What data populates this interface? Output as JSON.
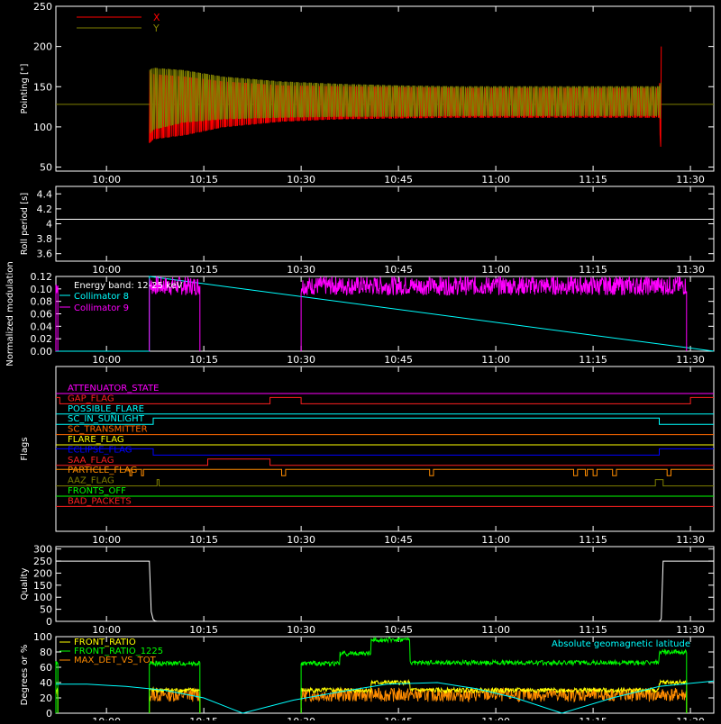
{
  "x_ticks": [
    "10:00",
    "10:15",
    "10:30",
    "10:45",
    "11:00",
    "11:15",
    "11:30"
  ],
  "x_tick_hours": [
    10.0,
    10.25,
    10.5,
    10.75,
    11.0,
    11.25,
    11.5
  ],
  "chart_data": [
    {
      "type": "line",
      "ylabel": "Pointing [\"]",
      "ylim": [
        45,
        250
      ],
      "yticks": [
        50,
        100,
        150,
        200,
        250
      ],
      "xlim": [
        9.87,
        11.56
      ],
      "legend_placement": "top-left",
      "series": [
        {
          "name": "X",
          "color": "#ff0000",
          "x": [
            10.11,
            10.12,
            10.2,
            10.3,
            10.45,
            10.6,
            10.75,
            10.9,
            11.05,
            11.2,
            11.3,
            11.42,
            11.425
          ],
          "center": [
            125,
            125,
            126,
            128,
            129,
            130,
            130,
            130,
            130,
            130,
            130,
            130,
            130
          ],
          "half_amp": [
            45,
            40,
            36,
            28,
            22,
            20,
            19,
            18,
            18,
            18,
            18,
            18,
            70
          ]
        },
        {
          "name": "Y",
          "color": "#808000",
          "x": [
            10.11,
            10.12,
            10.2,
            10.3,
            10.45,
            10.6,
            10.75,
            10.9,
            11.05,
            11.2,
            11.3,
            11.42,
            11.425
          ],
          "center": [
            130,
            135,
            138,
            136,
            134,
            133,
            132,
            132,
            132,
            132,
            132,
            132,
            130
          ],
          "half_amp": [
            40,
            38,
            32,
            26,
            22,
            20,
            19,
            18,
            18,
            18,
            18,
            18,
            25
          ]
        }
      ],
      "baseline": 128
    },
    {
      "type": "line",
      "ylabel": "Roll period [s]",
      "ylim": [
        3.5,
        4.5
      ],
      "yticks": [
        3.6,
        3.8,
        4.0,
        4.2,
        4.4
      ],
      "xlim": [
        9.87,
        11.56
      ],
      "series": [
        {
          "x": [
            9.87,
            11.56
          ],
          "y": [
            4.06,
            4.06
          ],
          "color": "#ffffff"
        }
      ]
    },
    {
      "type": "line",
      "ylabel": "Normalized modulation",
      "ylim": [
        0,
        0.12
      ],
      "yticks": [
        0.0,
        0.02,
        0.04,
        0.06,
        0.08,
        0.1,
        0.12
      ],
      "ytick_labels": [
        "0.00",
        "0.02",
        "0.04",
        "0.06",
        "0.08",
        "0.10",
        "0.12"
      ],
      "xlim": [
        9.87,
        11.56
      ],
      "legend": {
        "title": "Energy band: 12-25 keV",
        "entries": [
          "Collimator 8",
          "Collimator 9"
        ]
      },
      "series": [
        {
          "name": "Collimator 8",
          "color": "#00ffff",
          "x": [
            9.87,
            10.11,
            10.11,
            11.56
          ],
          "y": [
            0.0,
            0.0,
            0.12,
            0.0
          ]
        },
        {
          "name": "Collimator 9",
          "color": "#ff00ff",
          "segments": [
            [
              9.87,
              9.875
            ],
            [
              10.11,
              10.24
            ],
            [
              10.5,
              11.49
            ]
          ],
          "level_range": [
            0.09,
            0.12
          ]
        }
      ]
    },
    {
      "type": "table",
      "ylabel": "Flags",
      "xlim": [
        9.87,
        11.56
      ],
      "flags": [
        {
          "label": "ATTENUATOR_STATE",
          "color": "#ff00ff",
          "steps": []
        },
        {
          "label": "GAP_FLAG",
          "color": "#ff2020",
          "steps": [
            [
              9.87,
              1
            ],
            [
              9.88,
              0
            ],
            [
              10.42,
              1
            ],
            [
              10.5,
              0
            ],
            [
              11.5,
              1
            ]
          ]
        },
        {
          "label": "POSSIBLE_FLARE",
          "color": "#00ffff",
          "steps": []
        },
        {
          "label": "SC_IN_SUNLIGHT",
          "color": "#00ffff",
          "steps": [
            [
              9.87,
              0
            ],
            [
              10.12,
              1
            ],
            [
              11.42,
              0
            ]
          ]
        },
        {
          "label": "SC_TRANSMITTER",
          "color": "#ff6a00",
          "steps": []
        },
        {
          "label": "FLARE_FLAG",
          "color": "#ffff00",
          "steps": []
        },
        {
          "label": "ECLIPSE_FLAG",
          "color": "#0000ff",
          "steps": [
            [
              9.87,
              1
            ],
            [
              10.12,
              0
            ],
            [
              11.42,
              1
            ]
          ]
        },
        {
          "label": "SAA_FLAG",
          "color": "#ff2020",
          "steps": [
            [
              9.87,
              0
            ],
            [
              10.26,
              1
            ],
            [
              10.42,
              0
            ]
          ]
        },
        {
          "label": "PARTICLE_FLAG",
          "color": "#ff8c00",
          "steps": [
            [
              9.87,
              1
            ],
            [
              10.06,
              0
            ],
            [
              10.065,
              1
            ],
            [
              10.09,
              0
            ],
            [
              10.095,
              1
            ],
            [
              10.45,
              0
            ],
            [
              10.46,
              1
            ],
            [
              10.83,
              0
            ],
            [
              10.84,
              1
            ],
            [
              11.2,
              0
            ],
            [
              11.21,
              1
            ],
            [
              11.23,
              0
            ],
            [
              11.235,
              1
            ],
            [
              11.25,
              0
            ],
            [
              11.26,
              1
            ],
            [
              11.3,
              0
            ],
            [
              11.31,
              1
            ],
            [
              11.44,
              0
            ],
            [
              11.45,
              1
            ]
          ]
        },
        {
          "label": "AAZ_FLAG",
          "color": "#808000",
          "steps": [
            [
              9.87,
              0
            ],
            [
              10.13,
              1
            ],
            [
              10.135,
              0
            ],
            [
              11.41,
              1
            ],
            [
              11.43,
              0
            ]
          ]
        },
        {
          "label": "FRONTS_OFF",
          "color": "#00ff00",
          "steps": []
        },
        {
          "label": "BAD_PACKETS",
          "color": "#ff2020",
          "steps": []
        }
      ]
    },
    {
      "type": "line",
      "ylabel": "Quality",
      "ylim": [
        0,
        310
      ],
      "yticks": [
        0,
        50,
        100,
        150,
        200,
        250,
        300
      ],
      "xlim": [
        9.87,
        11.56
      ],
      "series": [
        {
          "color": "#ffffff",
          "x": [
            9.87,
            10.11,
            10.115,
            10.12,
            10.125,
            10.13,
            11.42,
            11.425,
            11.43,
            11.435,
            11.56
          ],
          "y": [
            250,
            250,
            40,
            8,
            2,
            0,
            0,
            10,
            250,
            250,
            250
          ]
        }
      ]
    },
    {
      "type": "line",
      "ylabel": "Degrees or %",
      "ylim": [
        0,
        100
      ],
      "yticks": [
        0,
        20,
        40,
        60,
        80,
        100
      ],
      "xlim": [
        9.87,
        11.56
      ],
      "annotation": "Absolute geomagnetic latitude",
      "series": [
        {
          "name": "FRONT_RATIO",
          "color": "#ffff00",
          "segments": [
            [
              9.87,
              9.875
            ],
            [
              10.11,
              10.24
            ],
            [
              10.5,
              11.49
            ]
          ],
          "levels": [
            [
              10.11,
              30
            ],
            [
              10.5,
              30
            ],
            [
              10.68,
              40
            ],
            [
              10.78,
              30
            ],
            [
              11.42,
              40
            ],
            [
              11.49,
              40
            ]
          ]
        },
        {
          "name": "FRONT_RATIO_1225",
          "color": "#00ff00",
          "segments": [
            [
              9.87,
              9.875
            ],
            [
              10.11,
              10.24
            ],
            [
              10.5,
              11.49
            ]
          ],
          "levels": [
            [
              10.11,
              65
            ],
            [
              10.5,
              65
            ],
            [
              10.6,
              78
            ],
            [
              10.68,
              96
            ],
            [
              10.78,
              66
            ],
            [
              11.42,
              80
            ],
            [
              11.49,
              80
            ]
          ]
        },
        {
          "name": "MAX_DET_VS_TOT",
          "color": "#ff8c00",
          "segments": [
            [
              9.87,
              9.875
            ],
            [
              10.11,
              10.24
            ],
            [
              10.5,
              11.49
            ]
          ],
          "levels": [
            [
              10.11,
              24
            ],
            [
              11.49,
              26
            ]
          ]
        },
        {
          "name": "",
          "color": "#00ffff",
          "x": [
            9.87,
            9.95,
            10.05,
            10.15,
            10.25,
            10.35,
            10.48,
            10.6,
            10.72,
            10.85,
            10.95,
            11.05,
            11.17,
            11.3,
            11.42,
            11.56
          ],
          "y": [
            38,
            38,
            35,
            30,
            20,
            0,
            17,
            28,
            38,
            40,
            32,
            20,
            0,
            20,
            35,
            42
          ]
        }
      ]
    }
  ]
}
